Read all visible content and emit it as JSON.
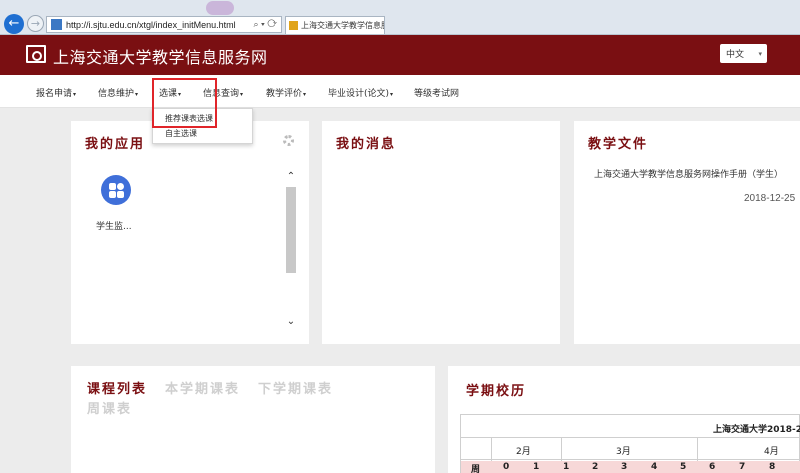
{
  "browser": {
    "url": "http://i.sjtu.edu.cn/xtgl/index_initMenu.html",
    "tab_title": "上海交通大学教学信息服务...",
    "tab_close": "×",
    "nav_back": "←",
    "nav_forward": "→",
    "address_controls": "⌕ ▾ ⟳"
  },
  "header": {
    "title": "上海交通大学教学信息服务网",
    "language": "中文",
    "language_caret": "▾",
    "background_color": "#7a0f12"
  },
  "menu": {
    "items": [
      {
        "label": "报名申请"
      },
      {
        "label": "信息维护"
      },
      {
        "label": "选课"
      },
      {
        "label": "信息查询"
      },
      {
        "label": "教学评价"
      },
      {
        "label": "毕业设计(论文)"
      },
      {
        "label": "等级考试网"
      }
    ],
    "caret": "▾",
    "dropdown": {
      "items": [
        {
          "label": "推荐课表选课"
        },
        {
          "label": "自主选课"
        }
      ]
    },
    "highlight_color": "#e0252a"
  },
  "apps": {
    "title": "我的应用",
    "items": [
      {
        "label": "学生监..."
      }
    ],
    "icon": "grid-apps-icon",
    "scroll_up": "⌃",
    "scroll_down": "⌄"
  },
  "messages": {
    "title": "我的消息"
  },
  "documents": {
    "title": "教学文件",
    "items": [
      {
        "title": "上海交通大学教学信息服务网操作手册（学生）",
        "date": "2018-12-25"
      }
    ]
  },
  "courses": {
    "tabs": [
      {
        "label": "课程列表",
        "active": true
      },
      {
        "label": "本学期课表",
        "active": false
      },
      {
        "label": "下学期课表",
        "active": false
      },
      {
        "label": "周课表",
        "active": false
      }
    ]
  },
  "calendar": {
    "title": "学期校历",
    "table_title": "上海交通大学2018-2",
    "months": [
      "2月",
      "3月",
      "4月"
    ],
    "week_label": "周",
    "week_numbers": [
      "0",
      "1",
      "1",
      "2",
      "3",
      "4",
      "5",
      "6",
      "7",
      "8"
    ]
  }
}
